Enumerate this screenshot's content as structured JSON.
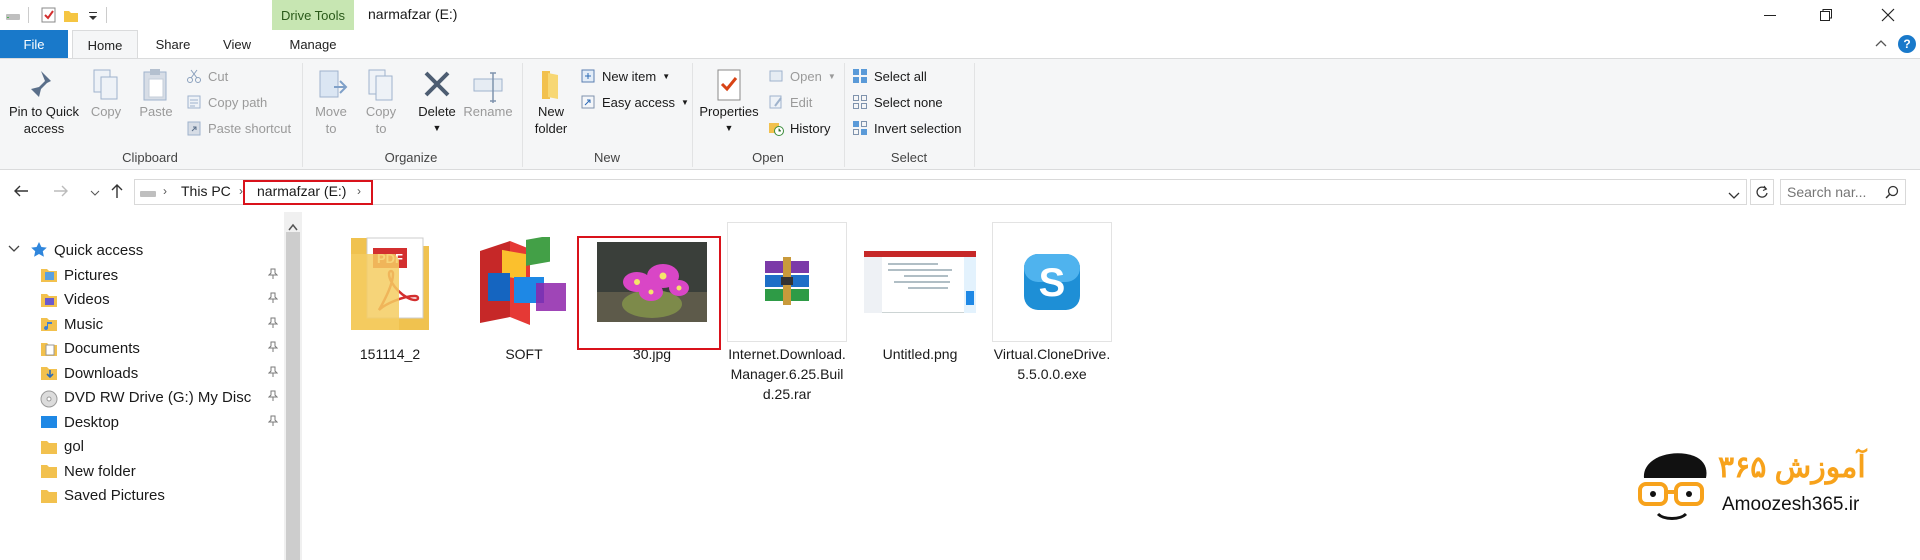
{
  "window": {
    "title": "narmafzar (E:)",
    "minimize_icon": "minimize-icon",
    "maximize_icon": "restore-icon",
    "close_icon": "close-icon"
  },
  "context_tab": {
    "group_label": "Drive Tools",
    "color": "#c7e6b2"
  },
  "tabs": [
    {
      "label": "File",
      "active": false
    },
    {
      "label": "Home",
      "active": true
    },
    {
      "label": "Share",
      "active": false
    },
    {
      "label": "View",
      "active": false
    },
    {
      "label": "Manage",
      "active": false
    }
  ],
  "ribbon": {
    "clipboard": {
      "label": "Clipboard",
      "pin_label_1": "Pin to Quick",
      "pin_label_2": "access",
      "copy_label": "Copy",
      "paste_label": "Paste",
      "cut_label": "Cut",
      "copy_path_label": "Copy path",
      "paste_shortcut_label": "Paste shortcut"
    },
    "organize": {
      "label": "Organize",
      "move_to_1": "Move",
      "move_to_2": "to",
      "copy_to_1": "Copy",
      "copy_to_2": "to",
      "delete_label": "Delete",
      "rename_label": "Rename"
    },
    "new": {
      "label": "New",
      "new_folder_1": "New",
      "new_folder_2": "folder",
      "new_item_label": "New item",
      "easy_access_label": "Easy access"
    },
    "open": {
      "label": "Open",
      "properties_label": "Properties",
      "open_label": "Open",
      "edit_label": "Edit",
      "history_label": "History"
    },
    "select": {
      "label": "Select",
      "select_all_label": "Select all",
      "select_none_label": "Select none",
      "invert_label": "Invert selection"
    }
  },
  "address": {
    "crumb_1": "This PC",
    "crumb_2": "narmafzar (E:)",
    "search_placeholder": "Search nar..."
  },
  "nav": {
    "quick_access_label": "Quick access",
    "items": [
      {
        "label": "Pictures",
        "icon": "pictures-folder-icon",
        "pinned": true
      },
      {
        "label": "Videos",
        "icon": "videos-folder-icon",
        "pinned": true
      },
      {
        "label": "Music",
        "icon": "music-folder-icon",
        "pinned": true
      },
      {
        "label": "Documents",
        "icon": "documents-folder-icon",
        "pinned": true
      },
      {
        "label": "Downloads",
        "icon": "downloads-folder-icon",
        "pinned": true
      },
      {
        "label": "DVD RW Drive (G:) My Disc",
        "icon": "dvd-drive-icon",
        "pinned": true
      },
      {
        "label": "Desktop",
        "icon": "desktop-folder-icon",
        "pinned": true
      },
      {
        "label": "gol",
        "icon": "folder-icon",
        "pinned": false
      },
      {
        "label": "New folder",
        "icon": "folder-icon",
        "pinned": false
      },
      {
        "label": "Saved Pictures",
        "icon": "folder-icon",
        "pinned": false
      }
    ]
  },
  "files": [
    {
      "name": "151114_2",
      "icon": "pdf-folder-icon"
    },
    {
      "name": "SOFT",
      "icon": "winrar-box-icon"
    },
    {
      "name": "30.jpg",
      "icon": "cactus-photo-thumbnail"
    },
    {
      "name": "Internet.Download.Manager.6.25.Build.25.rar",
      "icon": "rar-archive-icon"
    },
    {
      "name": "Untitled.png",
      "icon": "screenshot-thumbnail"
    },
    {
      "name": "Virtual.CloneDrive.5.5.0.0.exe",
      "icon": "clonedrive-s-icon"
    }
  ],
  "watermark": {
    "brand_fa": "آموزش ۳۶۵",
    "brand_en": "Amoozesh365.ir"
  },
  "colors": {
    "accent": "#1979ca",
    "highlight_box": "#d9121b",
    "watermark_orange": "#f7a21b"
  }
}
